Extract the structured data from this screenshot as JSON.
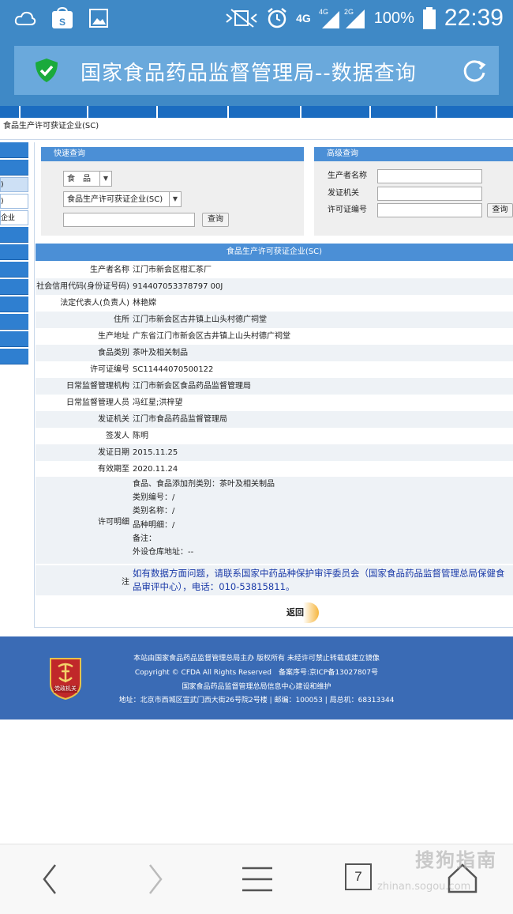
{
  "status": {
    "time": "22:39",
    "battery": "100%",
    "net1": "4G",
    "net2": "4G",
    "net3": "2G"
  },
  "address_bar": {
    "title": "国家食品药品监督管理局--数据查询"
  },
  "breadcrumb": "食品生产许可获证企业(SC)",
  "left_nav": [
    "",
    "",
    ")",
    ")",
    "企业",
    "",
    "",
    "",
    "",
    "",
    "",
    "",
    ""
  ],
  "quick_search": {
    "title": "快速查询",
    "select1": "食　品",
    "select2": "食品生产许可获证企业(SC)",
    "button": "查询"
  },
  "advanced_search": {
    "title": "高级查询",
    "fields": [
      "生产者名称",
      "发证机关",
      "许可证编号"
    ],
    "button": "查询"
  },
  "table": {
    "title": "食品生产许可获证企业(SC)",
    "rows": [
      {
        "k": "生产者名称",
        "v": "江门市新会区柑汇茶厂"
      },
      {
        "k": "社会信用代码(身份证号码)",
        "v": "914407053378797 00J"
      },
      {
        "k": "法定代表人(负责人)",
        "v": "林艳嫦"
      },
      {
        "k": "住所",
        "v": "江门市新会区古井镇上山头村德广祠堂"
      },
      {
        "k": "生产地址",
        "v": "广东省江门市新会区古井镇上山头村德广祠堂"
      },
      {
        "k": "食品类别",
        "v": "茶叶及相关制品"
      },
      {
        "k": "许可证编号",
        "v": "SC11444070500122"
      },
      {
        "k": "日常监督管理机构",
        "v": "江门市新会区食品药品监督管理局"
      },
      {
        "k": "日常监督管理人员",
        "v": "冯红星;洪梓望"
      },
      {
        "k": "发证机关",
        "v": "江门市食品药品监督管理局"
      },
      {
        "k": "签发人",
        "v": "陈明"
      },
      {
        "k": "发证日期",
        "v": "2015.11.25"
      },
      {
        "k": "有效期至",
        "v": "2020.11.24"
      }
    ],
    "permit_detail_label": "许可明细",
    "permit_detail_lines": [
      "食品、食品添加剂类别：茶叶及相关制品",
      "类别编号：/",
      "类别名称：/",
      "品种明细：/",
      "备注：",
      "外设仓库地址：--"
    ],
    "note_label": "注",
    "note_text": "如有数据方面问题，请联系国家中药品种保护审评委员会（国家食品药品监督管理总局保健食品审评中心），电话：010-53815811。"
  },
  "back_button": "返回",
  "footer": {
    "line1": "本站由国家食品药品监督管理总局主办 版权所有 未经许可禁止转载或建立镜像",
    "line2": "Copyright © CFDA All Rights Reserved　备案序号:京ICP备13027807号",
    "line3": "国家食品药品监督管理总局信息中心建设和维护",
    "line4": "地址：北京市西城区宣武门西大街26号院2号楼 | 邮编：100053 | 局总机：68313344",
    "emblem_text": "党政机关"
  },
  "bottom_nav": {
    "tab_count": "7"
  },
  "watermark": {
    "brand": "搜狗指南",
    "url": "zhinan.sogou.com"
  },
  "colors": {
    "status_bar": "#3f89c6",
    "nav_blue": "#1b6cc0",
    "panel_head": "#4b8fd6",
    "footer": "#3a6bb5",
    "note_text": "#1a3aa8"
  }
}
